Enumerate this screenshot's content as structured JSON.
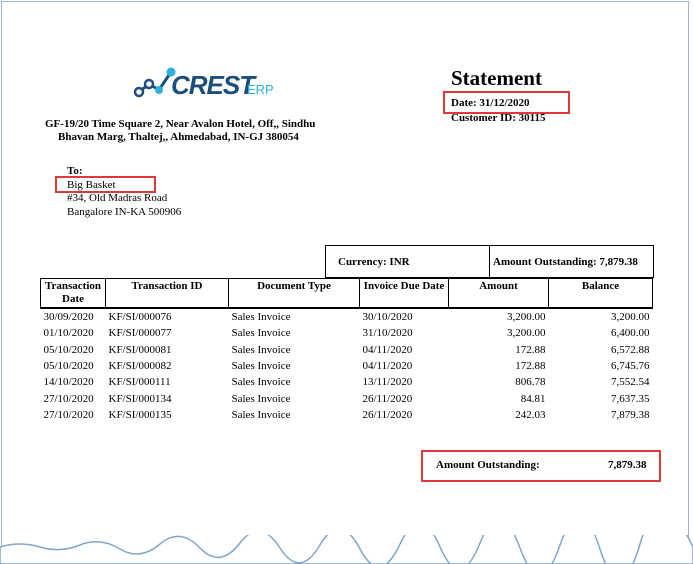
{
  "company": {
    "logo_text": "CREST",
    "logo_sub": "ERP",
    "address_line1": "GF-19/20 Time Square 2, Near Avalon Hotel, Off,, Sindhu",
    "address_line2": "Bhavan Marg, Thaltej,, Ahmedabad, IN-GJ 380054"
  },
  "statement": {
    "title": "Statement",
    "date": "Date: 31/12/2020",
    "customer_id": "Customer ID: 30115"
  },
  "to": {
    "label": "To:",
    "name": "Big Basket",
    "address1": "#34, Old Madras Road",
    "address2": "Bangalore IN-KA 500906"
  },
  "summary": {
    "currency": "Currency: INR",
    "amount_outstanding": "Amount Outstanding: 7,879.38"
  },
  "table": {
    "headers": [
      "Transaction Date",
      "Transaction ID",
      "Document Type",
      "Invoice Due Date",
      "Amount",
      "Balance"
    ],
    "rows": [
      [
        "30/09/2020",
        "KF/SI/000076",
        "Sales Invoice",
        "30/10/2020",
        "3,200.00",
        "3,200.00"
      ],
      [
        "01/10/2020",
        "KF/SI/000077",
        "Sales Invoice",
        "31/10/2020",
        "3,200.00",
        "6,400.00"
      ],
      [
        "05/10/2020",
        "KF/SI/000081",
        "Sales Invoice",
        "04/11/2020",
        "172.88",
        "6,572.88"
      ],
      [
        "05/10/2020",
        "KF/SI/000082",
        "Sales Invoice",
        "04/11/2020",
        "172.88",
        "6,745.76"
      ],
      [
        "14/10/2020",
        "KF/SI/000111",
        "Sales Invoice",
        "13/11/2020",
        "806.78",
        "7,552.54"
      ],
      [
        "27/10/2020",
        "KF/SI/000134",
        "Sales Invoice",
        "26/11/2020",
        "84.81",
        "7,637.35"
      ],
      [
        "27/10/2020",
        "KF/SI/000135",
        "Sales Invoice",
        "26/11/2020",
        "242.03",
        "7,879.38"
      ]
    ]
  },
  "footer": {
    "label": "Amount Outstanding:",
    "value": "7,879.38"
  },
  "colors": {
    "highlight": "#e0383a",
    "logo": "#1b4e7c",
    "logo_accent": "#2bb3d9"
  }
}
